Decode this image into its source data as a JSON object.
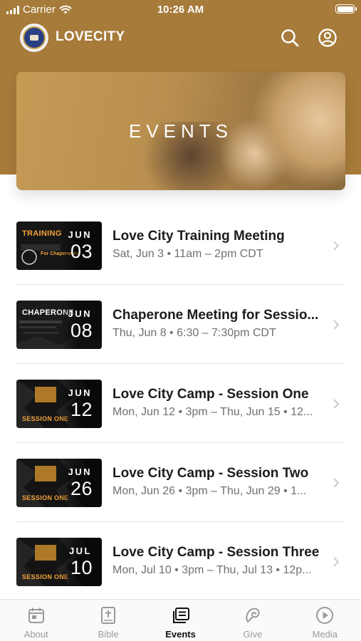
{
  "status_bar": {
    "carrier": "Carrier",
    "time": "10:26 AM"
  },
  "app": {
    "title": "LOVECITY"
  },
  "banner": {
    "title": "EVENTS"
  },
  "events": [
    {
      "title": "Love City Training Meeting",
      "subtitle": "Sat, Jun 3 • 11am – 2pm CDT",
      "month": "JUN",
      "day": "03",
      "thumb_text": "TRAINING"
    },
    {
      "title": "Chaperone Meeting for Sessio...",
      "subtitle": "Thu, Jun 8 • 6:30 – 7:30pm CDT",
      "month": "JUN",
      "day": "08",
      "thumb_text": "CHAPERONE"
    },
    {
      "title": "Love City Camp - Session One",
      "subtitle": "Mon, Jun 12 • 3pm – Thu, Jun 15 • 12...",
      "month": "JUN",
      "day": "12",
      "thumb_text": "SESSION ONE"
    },
    {
      "title": "Love City Camp - Session Two",
      "subtitle": "Mon, Jun 26 • 3pm – Thu, Jun 29 • 1...",
      "month": "JUN",
      "day": "26",
      "thumb_text": "SESSION ONE"
    },
    {
      "title": "Love City Camp - Session Three",
      "subtitle": "Mon, Jul 10 • 3pm – Thu, Jul 13 • 12p...",
      "month": "JUL",
      "day": "10",
      "thumb_text": "SESSION ONE"
    }
  ],
  "tabs": [
    {
      "label": "About",
      "icon": "calendar-icon",
      "active": false
    },
    {
      "label": "Bible",
      "icon": "bible-icon",
      "active": false
    },
    {
      "label": "Events",
      "icon": "events-icon",
      "active": true
    },
    {
      "label": "Give",
      "icon": "give-icon",
      "active": false
    },
    {
      "label": "Media",
      "icon": "play-icon",
      "active": false
    }
  ],
  "colors": {
    "brand": "#a77b3a",
    "thumb_accent": "#f3a23a",
    "active_tab": "#111111",
    "inactive_tab": "#9a9a9a"
  }
}
